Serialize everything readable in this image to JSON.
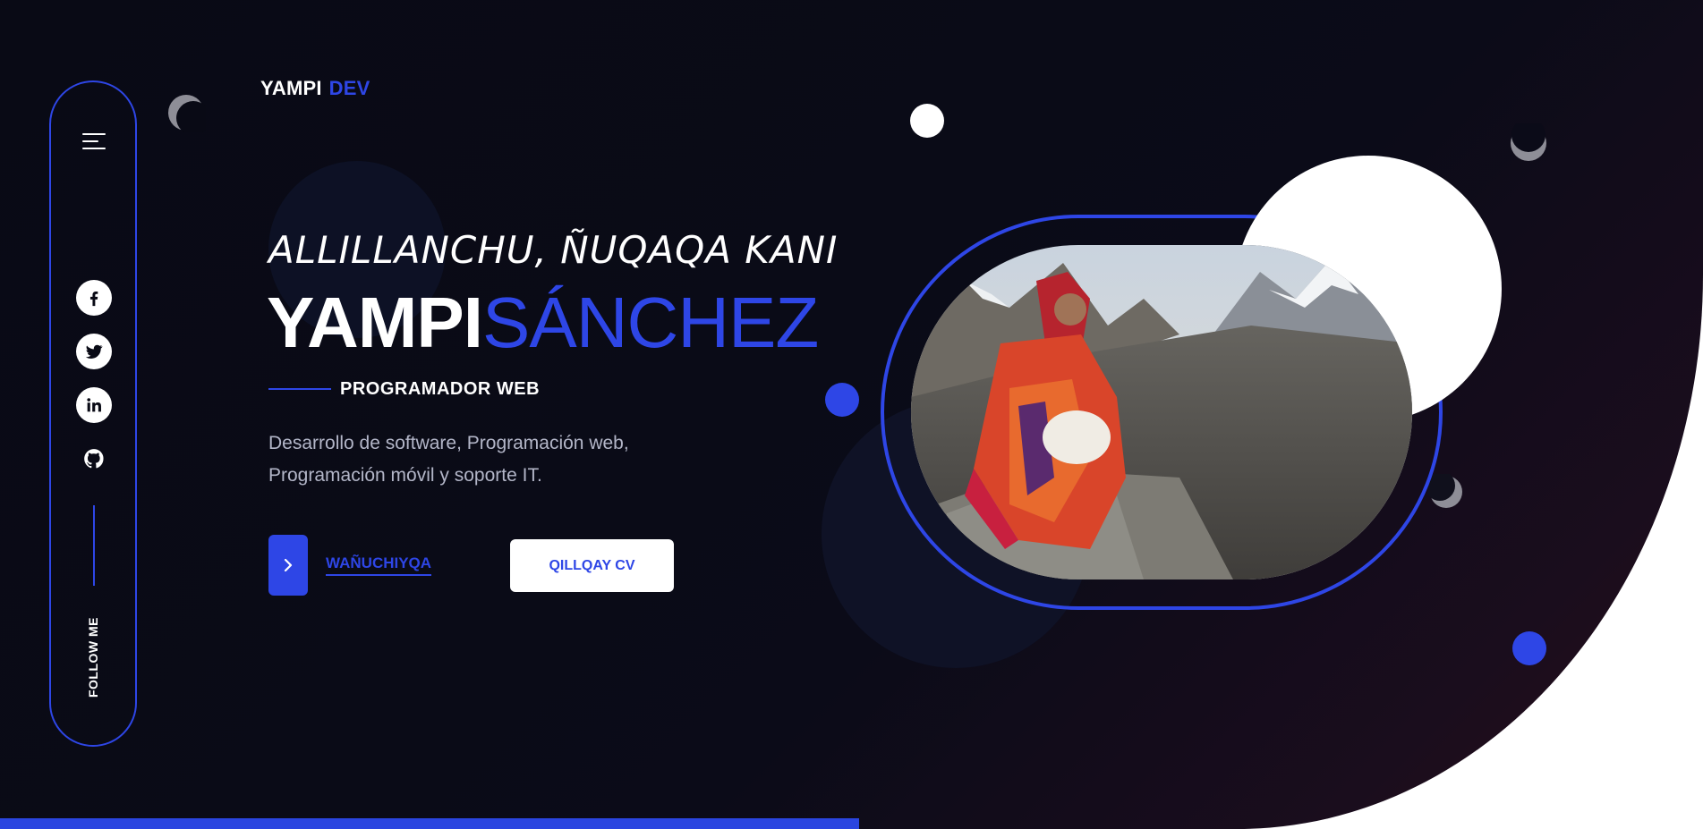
{
  "brand": {
    "name": "YAMPI",
    "accent": "DEV",
    "accent_color": "#2e46e6"
  },
  "sidebar": {
    "menu_icon": "hamburger-menu-icon",
    "socials": [
      {
        "name": "facebook",
        "icon": "facebook-icon"
      },
      {
        "name": "twitter",
        "icon": "twitter-icon"
      },
      {
        "name": "linkedin",
        "icon": "linkedin-icon"
      },
      {
        "name": "github",
        "icon": "github-icon"
      }
    ],
    "follow_label": "FOLLOW ME"
  },
  "hero": {
    "greeting": "ALLILLANCHU, ÑUQAQA KANI",
    "first_name": "YAMPI",
    "last_name": "SÁNCHEZ",
    "role": "PROGRAMADOR WEB",
    "description_line1": "Desarrollo de software, Programación web,",
    "description_line2": "Programación móvil y soporte IT.",
    "contact_label": "WAÑUCHIYQA",
    "cv_label": "QILLQAY CV"
  },
  "colors": {
    "background": "#090a15",
    "accent": "#2e46e6",
    "white": "#ffffff",
    "muted_text": "#b3b6c8"
  }
}
